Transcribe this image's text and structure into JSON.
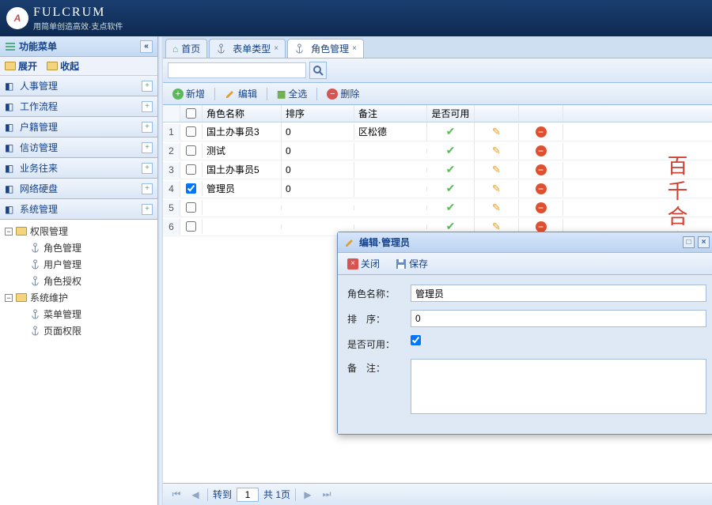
{
  "brand": {
    "name": "FULCRUM",
    "slogan": "用简单创造高效·支点软件"
  },
  "sidebar": {
    "title": "功能菜单",
    "expand": "展开",
    "collapse": "收起",
    "accordion": [
      {
        "label": "人事管理"
      },
      {
        "label": "工作流程"
      },
      {
        "label": "户籍管理"
      },
      {
        "label": "信访管理"
      },
      {
        "label": "业务往来"
      },
      {
        "label": "网络硬盘"
      },
      {
        "label": "系统管理"
      }
    ],
    "tree": {
      "g1": {
        "label": "权限管理",
        "children": [
          "角色管理",
          "用户管理",
          "角色授权"
        ]
      },
      "g2": {
        "label": "系统维护",
        "children": [
          "菜单管理",
          "页面权限"
        ]
      }
    }
  },
  "tabs": [
    {
      "label": "首页",
      "closable": false
    },
    {
      "label": "表单类型",
      "closable": true
    },
    {
      "label": "角色管理",
      "closable": true,
      "active": true
    }
  ],
  "toolbar": {
    "add": "新增",
    "edit": "编辑",
    "selall": "全选",
    "delete": "删除"
  },
  "grid": {
    "headers": {
      "name": "角色名称",
      "sort": "排序",
      "note": "备注",
      "avail": "是否可用"
    },
    "rows": [
      {
        "n": "1",
        "name": "国土办事员3",
        "sort": "0",
        "note": "区松德",
        "chk": false
      },
      {
        "n": "2",
        "name": "测试",
        "sort": "0",
        "note": "",
        "chk": false
      },
      {
        "n": "3",
        "name": "国土办事员5",
        "sort": "0",
        "note": "",
        "chk": false
      },
      {
        "n": "4",
        "name": "管理员",
        "sort": "0",
        "note": "",
        "chk": true
      },
      {
        "n": "5",
        "name": "",
        "sort": "",
        "note": "",
        "chk": false
      },
      {
        "n": "6",
        "name": "",
        "sort": "",
        "note": "",
        "chk": false
      }
    ]
  },
  "pager": {
    "pre": "转到",
    "page": "1",
    "mid": "共 1页"
  },
  "dialog": {
    "title": "编辑·管理员",
    "close": "关闭",
    "save": "保存",
    "f_name": "角色名称：",
    "f_sort": "排　序：",
    "f_avail": "是否可用：",
    "f_note": "备　注：",
    "v_name": "管理员",
    "v_sort": "0",
    "v_avail": true
  },
  "watermark": "百千合商城"
}
